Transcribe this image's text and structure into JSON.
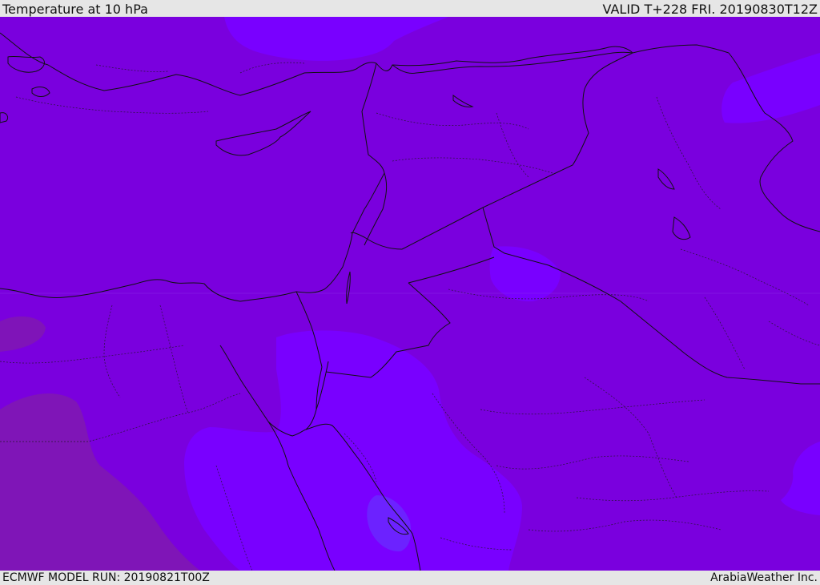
{
  "header": {
    "title": "Temperature at 10 hPa",
    "valid": "VALID T+228 FRI. 20190830T12Z"
  },
  "footer": {
    "model_run": "ECMWF MODEL RUN: 20190821T00Z",
    "credit": "ArabiaWeather Inc."
  },
  "map": {
    "background_color": "#7a00de",
    "warm_color": "#7f16b4",
    "cool_color": "#7900ff",
    "coolest_color": "#6c22ff",
    "coastline_color": "#111111",
    "border_color": "#222222"
  }
}
